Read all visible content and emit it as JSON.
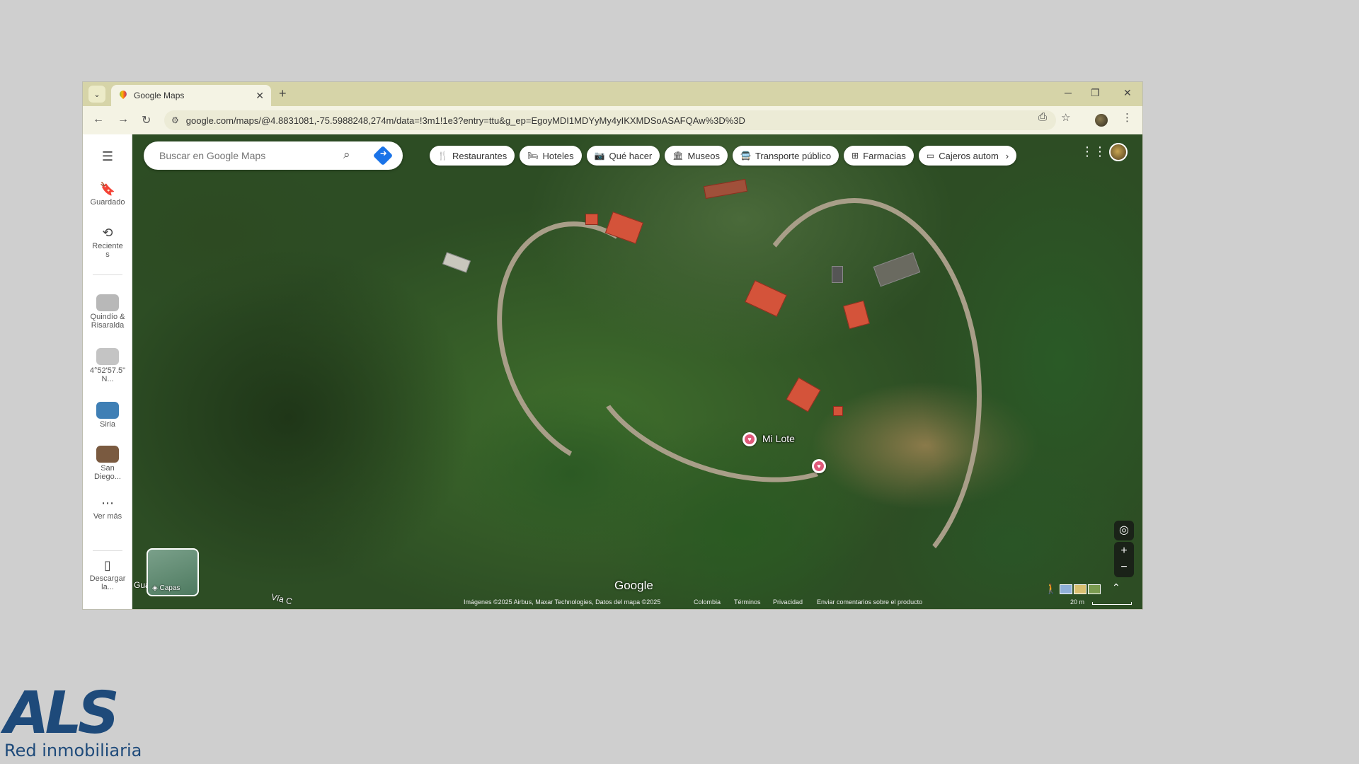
{
  "browser": {
    "tab": {
      "title": "Google Maps"
    },
    "new_tab": "+",
    "window_controls": {
      "minimize": "─",
      "restore": "❐",
      "close": "✕"
    },
    "url": "google.com/maps/@4.8831081,-75.5988248,274m/data=!3m1!1e3?entry=ttu&g_ep=EgoyMDI1MDYyMy4yIKXMDSoASAFQAw%3D%3D"
  },
  "maps": {
    "search": {
      "placeholder": "Buscar en Google Maps"
    },
    "chips": [
      {
        "label": "Restaurantes",
        "icon": "restaurant-icon",
        "glyph": "🍴"
      },
      {
        "label": "Hoteles",
        "icon": "hotel-icon",
        "glyph": "🛏"
      },
      {
        "label": "Qué hacer",
        "icon": "camera-icon",
        "glyph": "📷"
      },
      {
        "label": "Museos",
        "icon": "museum-icon",
        "glyph": "🏛"
      },
      {
        "label": "Transporte público",
        "icon": "bus-icon",
        "glyph": "🚍"
      },
      {
        "label": "Farmacias",
        "icon": "pharmacy-icon",
        "glyph": "⊞"
      },
      {
        "label": "Cajeros autom",
        "icon": "atm-icon",
        "glyph": "▭"
      }
    ],
    "rail": {
      "saved": "Guardado",
      "recents": "Reciente s",
      "recent_places": [
        {
          "label": "Quindío & Risaralda",
          "color": "#b8b8b8"
        },
        {
          "label": "4°52'57.5\" N...",
          "color": "#c4c4c4"
        },
        {
          "label": "Siria",
          "color": "#3f7fb5"
        },
        {
          "label": "San Diego...",
          "color": "#7a5a40"
        }
      ],
      "more": "Ver más",
      "download": "Descargar la..."
    },
    "marker": {
      "label": "Mi Lote"
    },
    "layers": "Capas",
    "google_logo": "Google",
    "zoom": {
      "in": "+",
      "out": "−"
    },
    "road_labels": [
      "Gua",
      "Vía C"
    ],
    "footer": {
      "imagery": "Imágenes ©2025 Airbus, Maxar Technologies, Datos del mapa ©2025",
      "country": "Colombia",
      "terms": "Términos",
      "privacy": "Privacidad",
      "feedback": "Enviar comentarios sobre el producto",
      "scale": "20 m"
    }
  },
  "watermark": {
    "mark": "ALS",
    "tagline": "Red inmobiliaria",
    "color": "#1e4a7a"
  }
}
